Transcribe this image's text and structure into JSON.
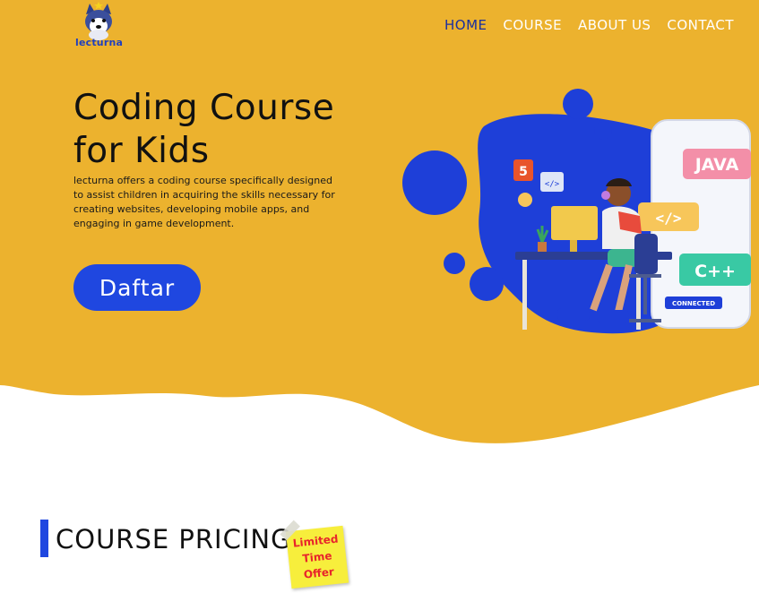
{
  "brand": {
    "name": "lecturna"
  },
  "nav": {
    "items": [
      {
        "label": "HOME",
        "active": true
      },
      {
        "label": "COURSE",
        "active": false
      },
      {
        "label": "ABOUT US",
        "active": false
      },
      {
        "label": "CONTACT",
        "active": false
      }
    ]
  },
  "hero": {
    "title": "Coding Course for Kids",
    "description": "lecturna offers a coding course specifically designed to assist children in acquiring the skills necessary for creating websites, developing mobile apps, and engaging in game development.",
    "cta_label": "Daftar",
    "illustration": {
      "labels": [
        "JAVA",
        "C++",
        "CONNECTED",
        "5"
      ]
    }
  },
  "pricing": {
    "heading": "COURSE PRICING",
    "badge_lines": [
      "Limited",
      "Time",
      "Offer"
    ]
  },
  "colors": {
    "hero_background": "#ecb22e",
    "accent_blue": "#1f47e0",
    "nav_active": "#1a2fa0",
    "badge_yellow": "#f7ee3c",
    "badge_text": "#e8242b"
  }
}
